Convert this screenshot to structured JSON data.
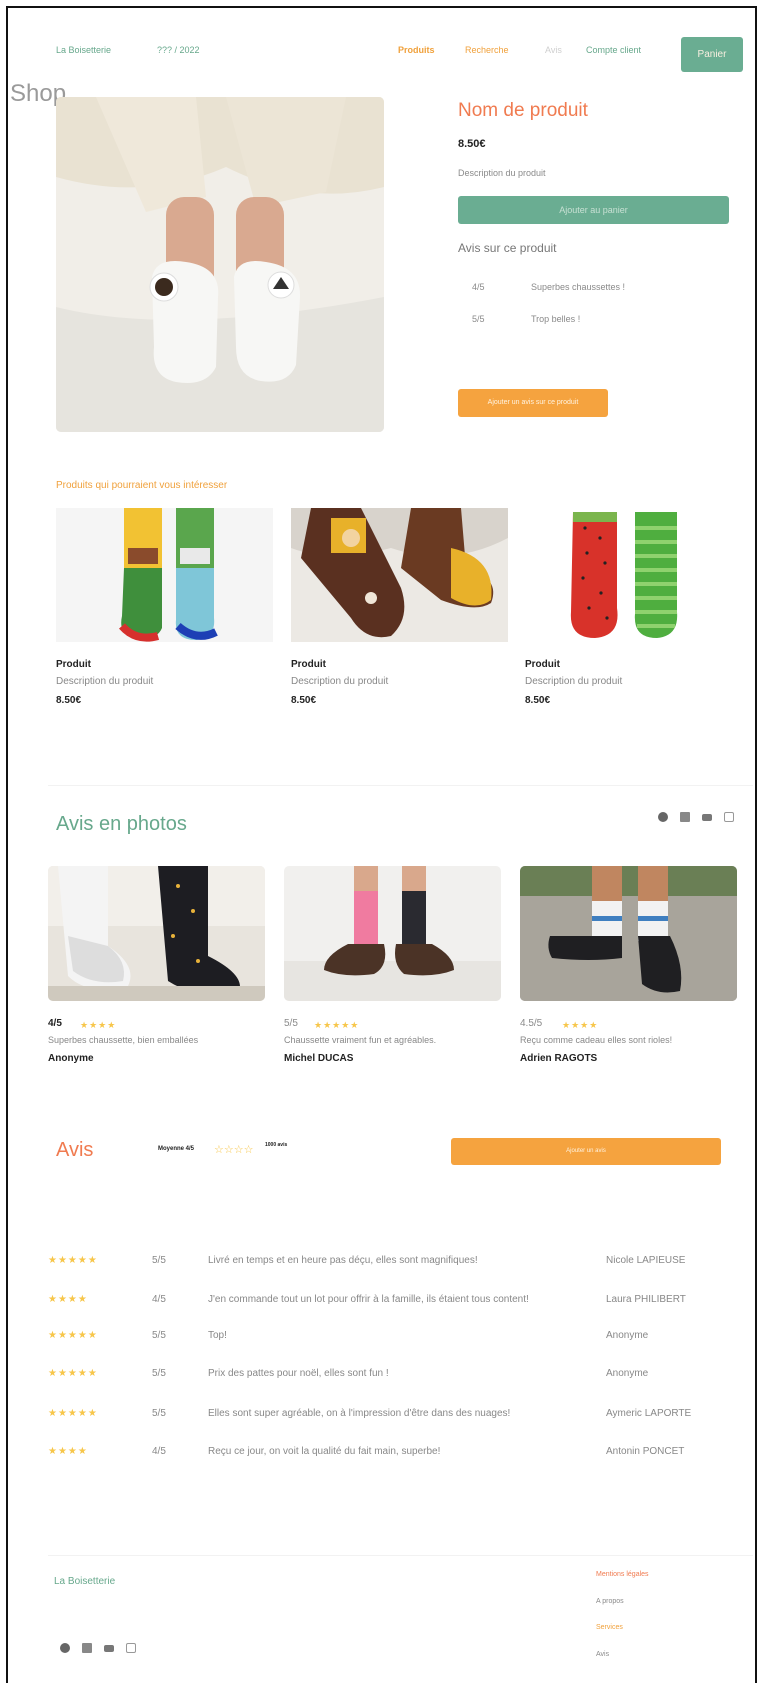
{
  "header": {
    "brand": "La Boisetterie",
    "slogan": "??? / 2022",
    "nav": [
      "Produits",
      "Recherche",
      "Avis",
      "Compte client"
    ],
    "cart_button": "Panier",
    "overlay_text": "Shop"
  },
  "product": {
    "name": "Nom de produit",
    "price": "8.50€",
    "description": "Description du produit",
    "add_button": "Ajouter au panier",
    "reviews_title": "Avis sur ce produit",
    "reviews": [
      {
        "score": "4/5",
        "text": "Superbes chaussettes !"
      },
      {
        "score": "5/5",
        "text": "Trop belles !"
      }
    ],
    "write_review_button": "Ajouter un avis sur ce produit"
  },
  "related": {
    "title": "Produits qui pourraient vous intéresser",
    "items": [
      {
        "title": "Produit",
        "desc": "Description du produit",
        "price": "8.50€"
      },
      {
        "title": "Produit",
        "desc": "Description du produit",
        "price": "8.50€"
      },
      {
        "title": "Produit",
        "desc": "Description du produit",
        "price": "8.50€"
      }
    ]
  },
  "photo_reviews": {
    "title": "Avis en photos",
    "items": [
      {
        "score": "4/5",
        "stars": "★★★★",
        "text": "Superbes chaussette, bien emballées",
        "author": "Anonyme"
      },
      {
        "score": "5/5",
        "stars": "★★★★★",
        "text": "Chaussette vraiment fun et agréables.",
        "author": "Michel DUCAS"
      },
      {
        "score": "4.5/5",
        "stars": "★★★★",
        "text": "Reçu comme cadeau elles sont rioles!",
        "author": "Adrien RAGOTS"
      }
    ]
  },
  "reviews": {
    "title": "Avis",
    "average": "Moyenne 4/5",
    "average_stars": "☆☆☆☆",
    "count": "1000 avis",
    "write_button": "Ajouter un avis",
    "rows": [
      {
        "stars": "★★★★★",
        "score": "5/5",
        "text": "Livré en temps et en heure pas déçu, elles sont magnifiques!",
        "author": "Nicole LAPIEUSE"
      },
      {
        "stars": "★★★★",
        "score": "4/5",
        "text": "J'en commande tout un lot pour offrir à la famille, ils étaient tous content!",
        "author": "Laura PHILIBERT"
      },
      {
        "stars": "★★★★★",
        "score": "5/5",
        "text": "Top!",
        "author": "Anonyme"
      },
      {
        "stars": "★★★★★",
        "score": "5/5",
        "text": "Prix des pattes pour noël, elles sont fun !",
        "author": "Anonyme"
      },
      {
        "stars": "★★★★★",
        "score": "5/5",
        "text": "Elles sont super agréable, on à l'impression d'être dans des nuages!",
        "author": "Aymeric LAPORTE"
      },
      {
        "stars": "★★★★",
        "score": "4/5",
        "text": "Reçu ce jour, on voit la qualité du fait main, superbe!",
        "author": "Antonin PONCET"
      }
    ]
  },
  "footer": {
    "brand": "La Boisetterie",
    "links": [
      "Mentions légales",
      "A propos",
      "Services",
      "Avis"
    ]
  },
  "colors": {
    "teal": "#67a88c",
    "orange": "#f0a13c",
    "coral": "#f07b50",
    "star": "#f7c64a"
  }
}
